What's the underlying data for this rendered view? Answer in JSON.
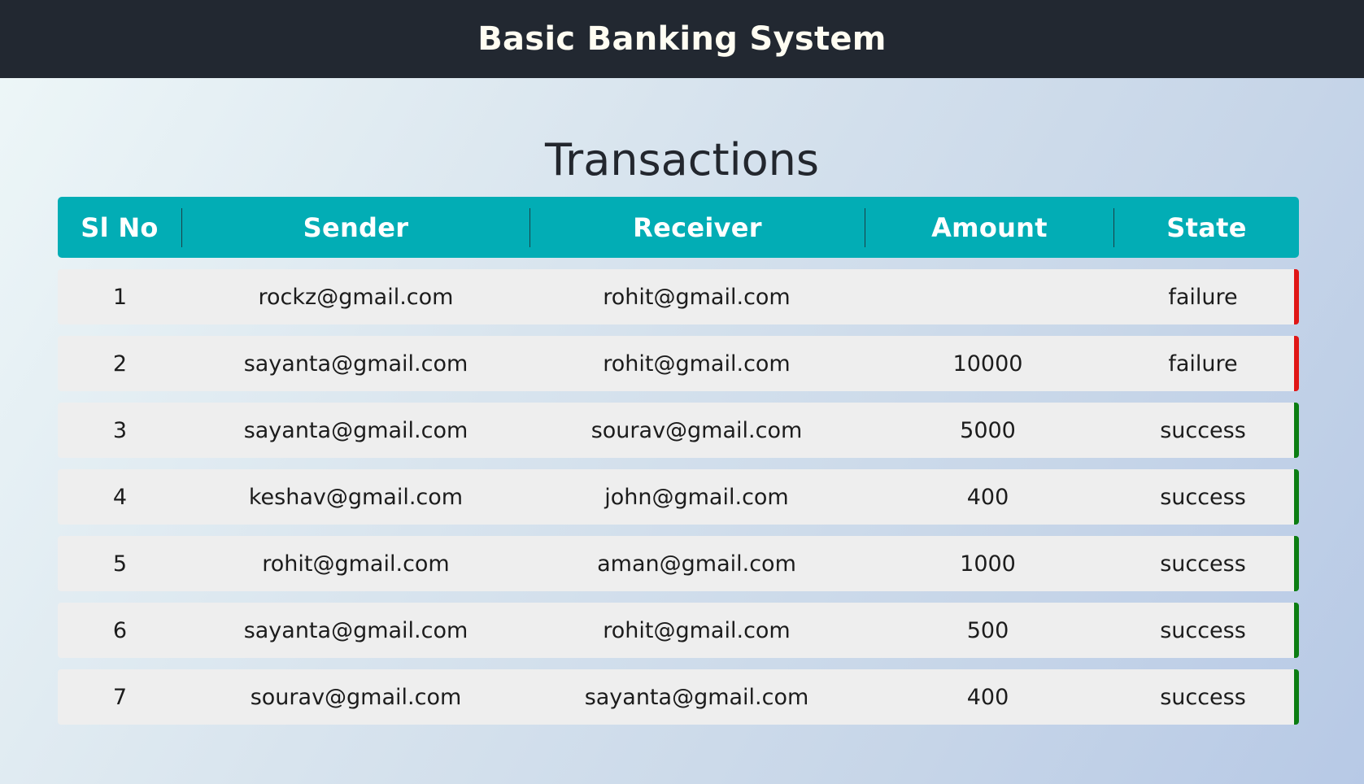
{
  "header": {
    "title": "Basic Banking System"
  },
  "page": {
    "title": "Transactions"
  },
  "table": {
    "columns": [
      "Sl No",
      "Sender",
      "Receiver",
      "Amount",
      "State"
    ],
    "rows": [
      {
        "sl": "1",
        "sender": "rockz@gmail.com",
        "receiver": "rohit@gmail.com",
        "amount": "",
        "state": "failure"
      },
      {
        "sl": "2",
        "sender": "sayanta@gmail.com",
        "receiver": "rohit@gmail.com",
        "amount": "10000",
        "state": "failure"
      },
      {
        "sl": "3",
        "sender": "sayanta@gmail.com",
        "receiver": "sourav@gmail.com",
        "amount": "5000",
        "state": "success"
      },
      {
        "sl": "4",
        "sender": "keshav@gmail.com",
        "receiver": "john@gmail.com",
        "amount": "400",
        "state": "success"
      },
      {
        "sl": "5",
        "sender": "rohit@gmail.com",
        "receiver": "aman@gmail.com",
        "amount": "1000",
        "state": "success"
      },
      {
        "sl": "6",
        "sender": "sayanta@gmail.com",
        "receiver": "rohit@gmail.com",
        "amount": "500",
        "state": "success"
      },
      {
        "sl": "7",
        "sender": "sourav@gmail.com",
        "receiver": "sayanta@gmail.com",
        "amount": "400",
        "state": "success"
      }
    ]
  },
  "colors": {
    "header_bg": "#222831",
    "table_head_bg": "#02adb5",
    "row_bg": "#eeeeee",
    "failure": "#e01616",
    "success": "#0b7d12"
  }
}
